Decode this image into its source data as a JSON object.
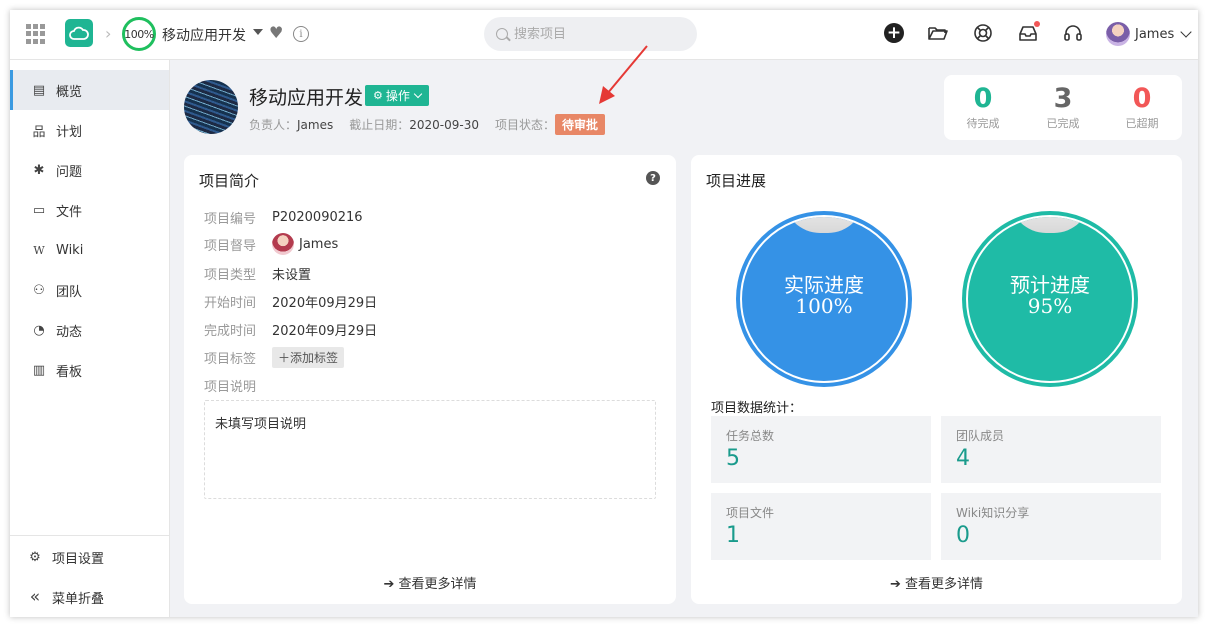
{
  "topbar": {
    "progress": "100%",
    "project_name": "移动应用开发",
    "search_placeholder": "搜索项目",
    "user_name": "James",
    "info_glyph": "i"
  },
  "sidebar": {
    "items": [
      {
        "label": "概览",
        "icon": "overview-icon",
        "glyph": "▤"
      },
      {
        "label": "计划",
        "icon": "plan-icon",
        "glyph": "品"
      },
      {
        "label": "问题",
        "icon": "bug-icon",
        "glyph": "✱"
      },
      {
        "label": "文件",
        "icon": "folder-icon",
        "glyph": "▭"
      },
      {
        "label": "Wiki",
        "icon": "wiki-icon",
        "glyph": "W"
      },
      {
        "label": "团队",
        "icon": "team-icon",
        "glyph": "⚇"
      },
      {
        "label": "动态",
        "icon": "activity-icon",
        "glyph": "◔"
      },
      {
        "label": "看板",
        "icon": "board-icon",
        "glyph": "▥"
      }
    ],
    "settings": "项目设置",
    "settings_glyph": "⚙",
    "collapse": "菜单折叠",
    "collapse_glyph": "«"
  },
  "header": {
    "title": "移动应用开发",
    "op_button": "操作",
    "op_glyph": "⚙",
    "owner_label": "负责人：",
    "owner": "James",
    "deadline_label": "截止日期：",
    "deadline": "2020-09-30",
    "status_label": "项目状态：",
    "status": "待审批"
  },
  "stats": [
    {
      "value": "0",
      "label": "待完成",
      "color": "#1fb593"
    },
    {
      "value": "3",
      "label": "已完成",
      "color": "#666666"
    },
    {
      "value": "0",
      "label": "已超期",
      "color": "#f25757"
    }
  ],
  "intro": {
    "title": "项目简介",
    "help_glyph": "?",
    "rows": [
      {
        "k": "项目编号",
        "v": "P2020090216"
      },
      {
        "k": "项目督导",
        "v": "James"
      },
      {
        "k": "项目类型",
        "v": "未设置"
      },
      {
        "k": "开始时间",
        "v": "2020年09月29日"
      },
      {
        "k": "完成时间",
        "v": "2020年09月29日"
      },
      {
        "k": "项目标签",
        "v": "＋添加标签"
      },
      {
        "k": "项目说明",
        "v": ""
      }
    ],
    "description": "未填写项目说明",
    "more": "查看更多详情"
  },
  "progress": {
    "title": "项目进展",
    "actual_label": "实际进度",
    "actual_value": "100%",
    "planned_label": "预计进度",
    "planned_value": "95%",
    "stats_title": "项目数据统计：",
    "boxes": [
      {
        "label": "任务总数",
        "value": "5"
      },
      {
        "label": "团队成员",
        "value": "4"
      },
      {
        "label": "项目文件",
        "value": "1"
      },
      {
        "label": "Wiki知识分享",
        "value": "0"
      }
    ],
    "more": "查看更多详情"
  },
  "colors": {
    "accent": "#1fb593",
    "blue": "#3592e6",
    "teal": "#1fbba6",
    "status": "#e88766"
  },
  "arrow_glyph": "➔"
}
